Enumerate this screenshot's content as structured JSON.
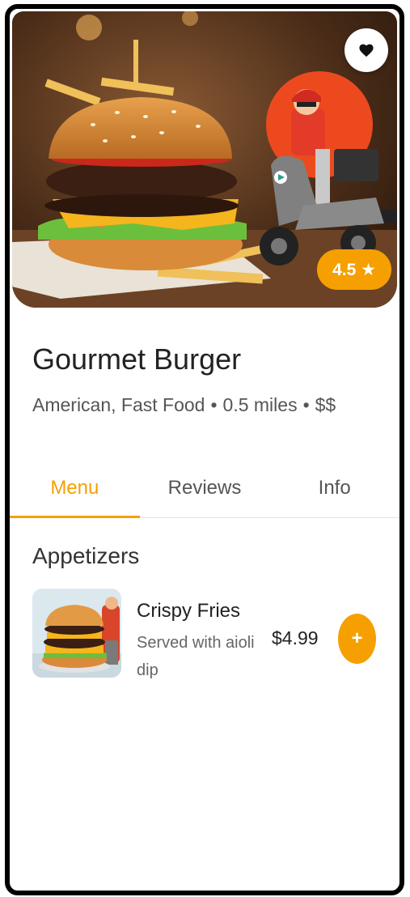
{
  "restaurant": {
    "name": "Gourmet Burger",
    "cuisine": "American, Fast Food",
    "distance": "0.5 miles",
    "price_level": "$$",
    "separator": "•",
    "rating": "4.5 ★"
  },
  "hero": {
    "favorite_icon": "heart-icon",
    "image": "burger-with-delivery-scooter"
  },
  "tabs": [
    {
      "label": "Menu",
      "active": true
    },
    {
      "label": "Reviews",
      "active": false
    },
    {
      "label": "Info",
      "active": false
    }
  ],
  "menu": {
    "section_title": "Appetizers",
    "items": [
      {
        "name": "Crispy Fries",
        "description": "Served with aioli dip",
        "price": "$4.99",
        "add_label": "+"
      }
    ]
  },
  "colors": {
    "accent": "#F5A000",
    "text_primary": "#222222",
    "text_secondary": "#555555"
  }
}
